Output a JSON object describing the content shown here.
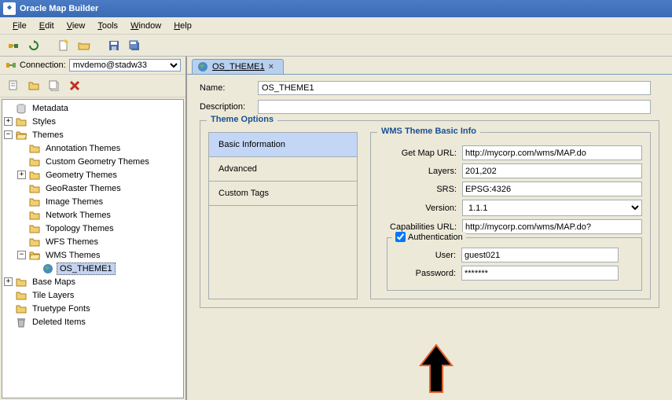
{
  "window": {
    "title": "Oracle Map Builder"
  },
  "menu": {
    "file": "File",
    "edit": "Edit",
    "view": "View",
    "tools": "Tools",
    "window": "Window",
    "help": "Help"
  },
  "connection": {
    "label": "Connection:",
    "value": "mvdemo@stadw33"
  },
  "tree": {
    "root": "Metadata",
    "styles": "Styles",
    "themes": "Themes",
    "annotation": "Annotation Themes",
    "customGeom": "Custom Geometry Themes",
    "geometry": "Geometry Themes",
    "georaster": "GeoRaster Themes",
    "image": "Image Themes",
    "network": "Network Themes",
    "topology": "Topology Themes",
    "wfs": "WFS Themes",
    "wms": "WMS Themes",
    "wmsItem": "OS_THEME1",
    "baseMaps": "Base Maps",
    "tileLayers": "Tile Layers",
    "truetype": "Truetype Fonts",
    "deleted": "Deleted Items"
  },
  "tab": {
    "label": "OS_THEME1"
  },
  "editor": {
    "nameLabel": "Name:",
    "nameValue": "OS_THEME1",
    "descLabel": "Description:",
    "descValue": "",
    "themeOptions": "Theme Options",
    "nav": {
      "basic": "Basic Information",
      "advanced": "Advanced",
      "custom": "Custom Tags"
    },
    "wmsGroup": "WMS Theme Basic Info",
    "getMapUrlLabel": "Get Map URL:",
    "getMapUrl": "http://mycorp.com/wms/MAP.do",
    "layersLabel": "Layers:",
    "layers": "201,202",
    "srsLabel": "SRS:",
    "srs": "EPSG:4326",
    "versionLabel": "Version:",
    "version": "1.1.1",
    "capUrlLabel": "Capabilities URL:",
    "capUrl": "http://mycorp.com/wms/MAP.do?",
    "authLabel": "Authentication",
    "authChecked": true,
    "userLabel": "User:",
    "user": "guest021",
    "passwordLabel": "Password:",
    "password": "*******"
  }
}
